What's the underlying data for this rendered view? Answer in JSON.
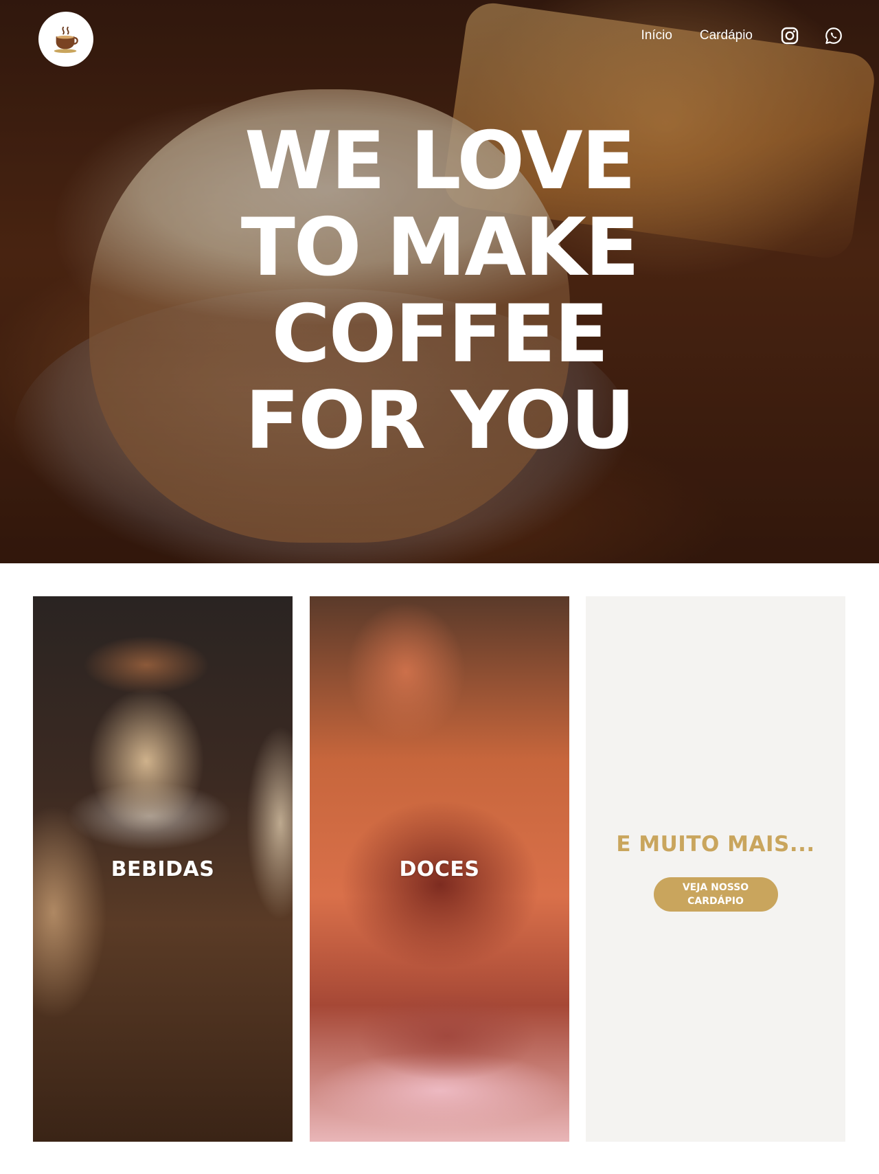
{
  "header": {
    "logo_icon": "coffee-cup-icon",
    "nav": {
      "home": "Início",
      "menu": "Cardápio"
    },
    "social": {
      "instagram_icon": "instagram-icon",
      "whatsapp_icon": "whatsapp-icon"
    }
  },
  "hero": {
    "headline_lines": [
      "WE LOVE",
      "TO MAKE",
      "COFFEE",
      "FOR YOU"
    ]
  },
  "cards": {
    "drinks": {
      "label": "BEBIDAS"
    },
    "sweets": {
      "label": "DOCES"
    },
    "more": {
      "title": "E MUITO MAIS...",
      "button_line1": "VEJA NOSSO",
      "button_line2": "CARDÁPIO"
    }
  },
  "colors": {
    "accent": "#c9a55d",
    "panel": "#f4f3f1",
    "text_light": "#ffffff"
  }
}
